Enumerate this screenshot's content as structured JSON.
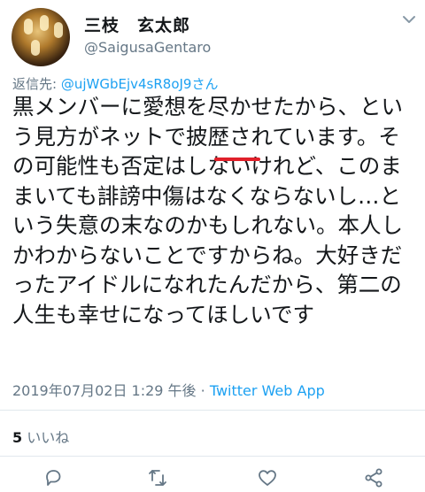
{
  "author": {
    "display_name": "三枝　玄太郎",
    "handle": "@SaigusaGentaro",
    "avatar_icon": "profile-photo"
  },
  "reply": {
    "prefix": "返信先: ",
    "mention": "@ujWGbEjv4sR8oJ9さん"
  },
  "tweet": {
    "text": "黒メンバーに愛想を尽かせたから、という見方がネットで披歴されています。その可能性も否定はしないけれど、このままいても誹謗中傷はなくならないし…という失意の末なのかもしれない。本人しかわからないことですからね。大好きだったアイドルになれたんだから、第二の人生も幸せになってほしいです"
  },
  "meta": {
    "timestamp": "2019年07月02日 1:29 午後",
    "separator": " · ",
    "app": "Twitter Web App"
  },
  "stats": {
    "likes_count": "5",
    "likes_label": "いいね"
  },
  "icons": [
    "chevron-down-icon",
    "reply-icon",
    "retweet-icon",
    "like-icon",
    "share-icon"
  ],
  "colors": {
    "text": "#14171a",
    "secondary": "#657786",
    "link": "#1da1f2",
    "highlight_underline": "#e0202a"
  }
}
